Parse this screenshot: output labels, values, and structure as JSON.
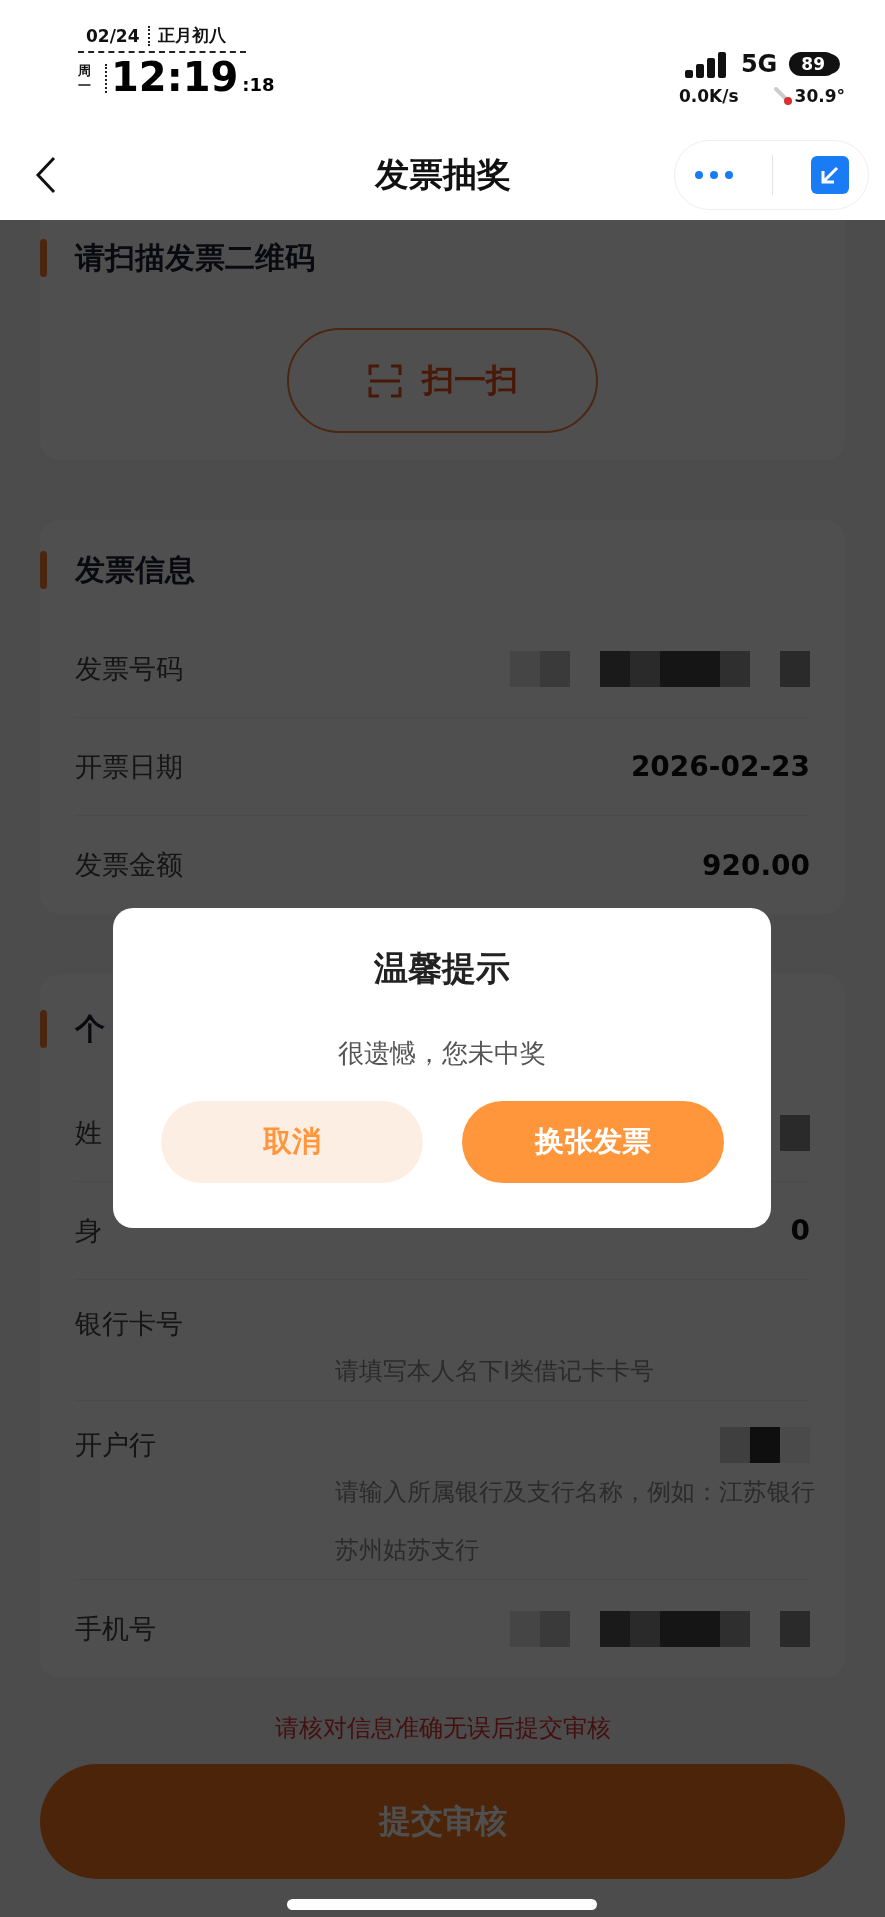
{
  "status_bar": {
    "date": "02/24",
    "lunar_date": "正月初八",
    "weekday": "周一",
    "time": "12:19",
    "seconds": ":18",
    "network": "5G",
    "battery": "89",
    "speed": "0.0K/s",
    "temperature": "30.9°"
  },
  "nav": {
    "title": "发票抽奖"
  },
  "scan_section": {
    "title": "请扫描发票二维码",
    "button": "扫一扫"
  },
  "invoice_section": {
    "title": "发票信息",
    "rows": [
      {
        "label": "发票号码",
        "kind": "redacted"
      },
      {
        "label": "开票日期",
        "kind": "text",
        "value": "2026-02-23"
      },
      {
        "label": "发票金额",
        "kind": "text",
        "value": "920.00"
      }
    ]
  },
  "personal_section": {
    "title": "个",
    "rows": [
      {
        "label": "姓",
        "kind": "redacted"
      },
      {
        "label": "身",
        "kind": "text",
        "value": "0"
      },
      {
        "label": "银行卡号",
        "kind": "field",
        "placeholder": "请填写本人名下I类借记卡卡号",
        "redacted": false
      },
      {
        "label": "开户行",
        "kind": "field",
        "placeholder": "请输入所属银行及支行名称，例如：江苏银行苏州姑苏支行",
        "redacted": true
      },
      {
        "label": "手机号",
        "kind": "redacted"
      }
    ]
  },
  "footer": {
    "notice": "请核对信息准确无误后提交审核",
    "submit": "提交审核"
  },
  "dialog": {
    "title": "温馨提示",
    "message": "很遗憾，您未中奖",
    "buttons": [
      {
        "label": "取消",
        "kind": "secondary"
      },
      {
        "label": "换张发票",
        "kind": "primary"
      }
    ]
  }
}
